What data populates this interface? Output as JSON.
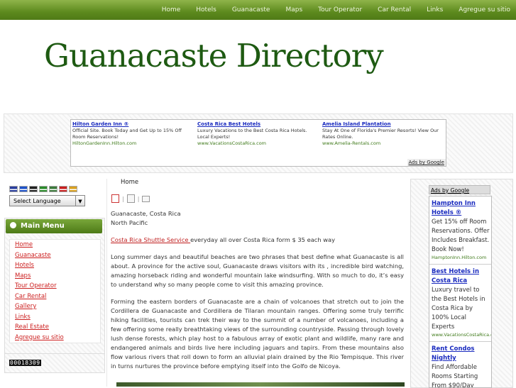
{
  "nav": [
    "Home",
    "Hotels",
    "Guanacaste",
    "Maps",
    "Tour Operator",
    "Car Rental",
    "Links",
    "Agregue su sitio"
  ],
  "site_title": "Guanacaste Directory",
  "top_ads": [
    {
      "title": "Hilton Garden Inn ®",
      "text": "Official Site. Book Today and Get Up to 15% Off Room Reservations!",
      "url": "HiltonGardenInn.Hilton.com"
    },
    {
      "title": "Costa Rica Best Hotels",
      "text": "Luxury Vacations to the Best Costa Rica Hotels. Local Experts!",
      "url": "www.VacationsCostaRica.com"
    },
    {
      "title": "Amelia Island Plantation",
      "text": "Stay At One of Florida's Premier Resorts! View Our Rates Online.",
      "url": "www.Amelia-Rentals.com"
    }
  ],
  "ads_by": "Ads by Google",
  "language": {
    "selected": "Select Language",
    "flag_colors": [
      "#2a3f9e",
      "#1e52c8",
      "#222222",
      "#2a8a2a",
      "#3c7a3c",
      "#c82020",
      "#d9a020"
    ]
  },
  "main_menu": {
    "title": "Main Menu",
    "items": [
      "Home",
      "Guanacaste",
      "Hotels",
      "Maps",
      "Tour Operator",
      "Car Rental",
      "Gallery",
      "Links",
      "Real Estate",
      "Agregue su sitio"
    ]
  },
  "counter": "00018309",
  "breadcrumb": "Home",
  "content": {
    "location_line1": "Guanacaste, Costa Rica",
    "location_line2": "North Pacific",
    "shuttle_link": "Costa Rica Shuttle Service ",
    "shuttle_text": "everyday all over Costa Rica form $ 35 each way",
    "para1": "Long summer days and beautiful beaches are two phrases that best define what Guanacaste is all about. A province for the active soul, Guanacaste draws visitors with its , incredible bird watching, amazing horseback riding and wonderful mountain lake windsurfing. With so much to do, it’s easy to understand why so many people come to visit this amazing province.",
    "para2": "Forming the eastern borders of Guanacaste are a chain of volcanoes that stretch out to join the Cordillera de Guanacaste and Cordillera de Tilaran mountain ranges. Offering some truly terrific hiking facilities, tourists can trek their way to the summit of a number of volcanoes, including a few offering some really breathtaking views of the surrounding countryside. Passing through lovely lush dense forests, which play host to a fabulous array of exotic plant and wildlife, many rare and endangered animals and birds live here including jaguars and tapirs. From these mountains also flow various rivers that roll down to form an alluvial plain drained by the Rio Tempisque. This river in turns nurtures the province before emptying itself into the Golfo de Nicoya."
  },
  "side_ads": [
    {
      "title": "Hampton Inn Hotels ®",
      "text": "Get 15% off Room Reservations. Offer Includes Breakfast. Book Now!",
      "url": "HamptonInn.Hilton.com"
    },
    {
      "title": "Best Hotels in Costa Rica",
      "text": "Luxury travel to the Best Hotels in Costa Rica by 100% Local Experts",
      "url": "www.VacationsCostaRica.com"
    },
    {
      "title": "Rent Condos Nightly",
      "text": "Find Affordable Rooms Starting From $90/Day",
      "url": ""
    }
  ]
}
